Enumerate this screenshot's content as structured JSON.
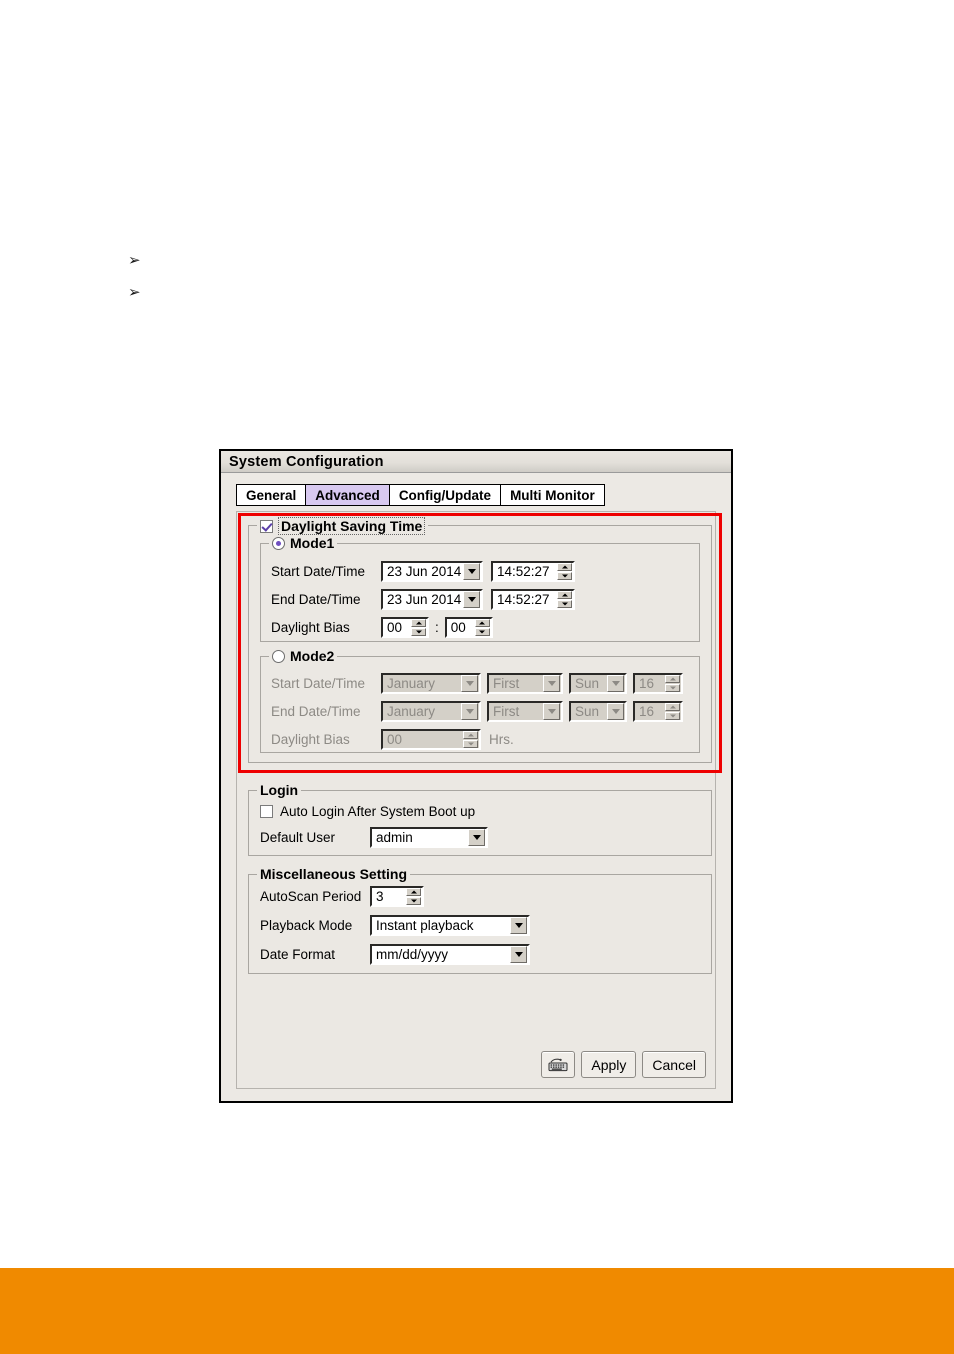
{
  "page": {
    "bullets": [
      "➢",
      "➢"
    ],
    "footer_band_color": "#f08a00"
  },
  "dialog": {
    "title": "System Configuration",
    "tabs": [
      {
        "label": "General",
        "active": false
      },
      {
        "label": "Advanced",
        "active": true
      },
      {
        "label": "Config/Update",
        "active": false
      },
      {
        "label": "Multi Monitor",
        "active": false
      }
    ],
    "highlight_color": "#ee0000",
    "active_tab_color": "#d8c9f0"
  },
  "dst": {
    "legend": "Daylight Saving Time",
    "checkbox_checked": true,
    "mode1": {
      "legend": "Mode1",
      "selected": true,
      "start_label": "Start Date/Time",
      "start_date": "23 Jun 2014",
      "start_time": "14:52:27",
      "end_label": "End Date/Time",
      "end_date": "23 Jun 2014",
      "end_time": "14:52:27",
      "bias_label": "Daylight Bias",
      "bias_hours": "00",
      "bias_separator": ":",
      "bias_minutes": "00"
    },
    "mode2": {
      "legend": "Mode2",
      "selected": false,
      "start_label": "Start Date/Time",
      "start_month": "January",
      "start_week": "First",
      "start_day": "Sun",
      "start_hour": "16",
      "end_label": "End Date/Time",
      "end_month": "January",
      "end_week": "First",
      "end_day": "Sun",
      "end_hour": "16",
      "bias_label": "Daylight Bias",
      "bias_value": "00",
      "bias_unit": "Hrs."
    }
  },
  "login": {
    "legend": "Login",
    "auto_login_label": "Auto Login After System Boot up",
    "auto_login_checked": false,
    "default_user_label": "Default User",
    "default_user_value": "admin"
  },
  "misc": {
    "legend": "Miscellaneous Setting",
    "autoscan_label": "AutoScan Period",
    "autoscan_value": "3",
    "playback_label": "Playback Mode",
    "playback_value": "Instant playback",
    "date_format_label": "Date Format",
    "date_format_value": "mm/dd/yyyy"
  },
  "footer": {
    "keyboard_icon": "keyboard-icon",
    "apply_label": "Apply",
    "cancel_label": "Cancel"
  }
}
